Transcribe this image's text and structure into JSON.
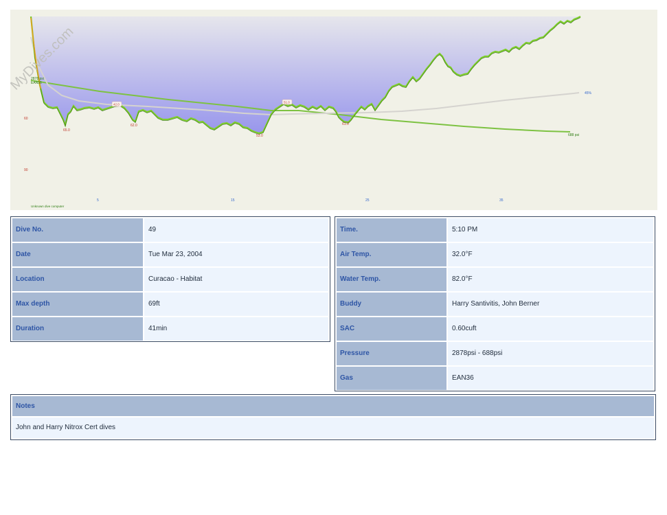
{
  "watermark": "MyDives.com",
  "profile": {
    "footer_label": "Unknown dive computer",
    "x_ticks": [
      "5",
      "15",
      "25",
      "35"
    ],
    "y_ticks": [
      "60",
      "90"
    ],
    "depth_labels": [
      "65.0",
      "62.0",
      "53.0",
      "61.0"
    ],
    "callouts": [
      "42.0",
      "51.0"
    ],
    "start_pressure_label": "2878 psi",
    "gas_label": "EAN36",
    "end_pressure_label": "688 psi",
    "right_pct_label": "45%",
    "colors": {
      "fill_top": "#e3e3ea",
      "fill_bottom": "#9a98ec",
      "depth_line": "#7fcf2a",
      "pressure_line": "#7dc242",
      "depth_tick": "#c0392b"
    }
  },
  "left_table": [
    {
      "label": "Dive No.",
      "value": "49"
    },
    {
      "label": "Date",
      "value": "Tue Mar 23, 2004"
    },
    {
      "label": "Location",
      "value": "Curacao - Habitat"
    },
    {
      "label": "Max depth",
      "value": "69ft"
    },
    {
      "label": "Duration",
      "value": "41min"
    }
  ],
  "right_table": [
    {
      "label": "Time.",
      "value": "5:10 PM"
    },
    {
      "label": "Air Temp.",
      "value": "32.0°F"
    },
    {
      "label": "Water Temp.",
      "value": "82.0°F"
    },
    {
      "label": "Buddy",
      "value": "Harry Santivitis, John Berner"
    },
    {
      "label": "SAC",
      "value": "0.60cuft"
    },
    {
      "label": "Pressure",
      "value": "2878psi - 688psi"
    },
    {
      "label": "Gas",
      "value": "EAN36"
    }
  ],
  "notes": {
    "heading": "Notes",
    "text": "John and Harry Nitrox Cert dives"
  }
}
